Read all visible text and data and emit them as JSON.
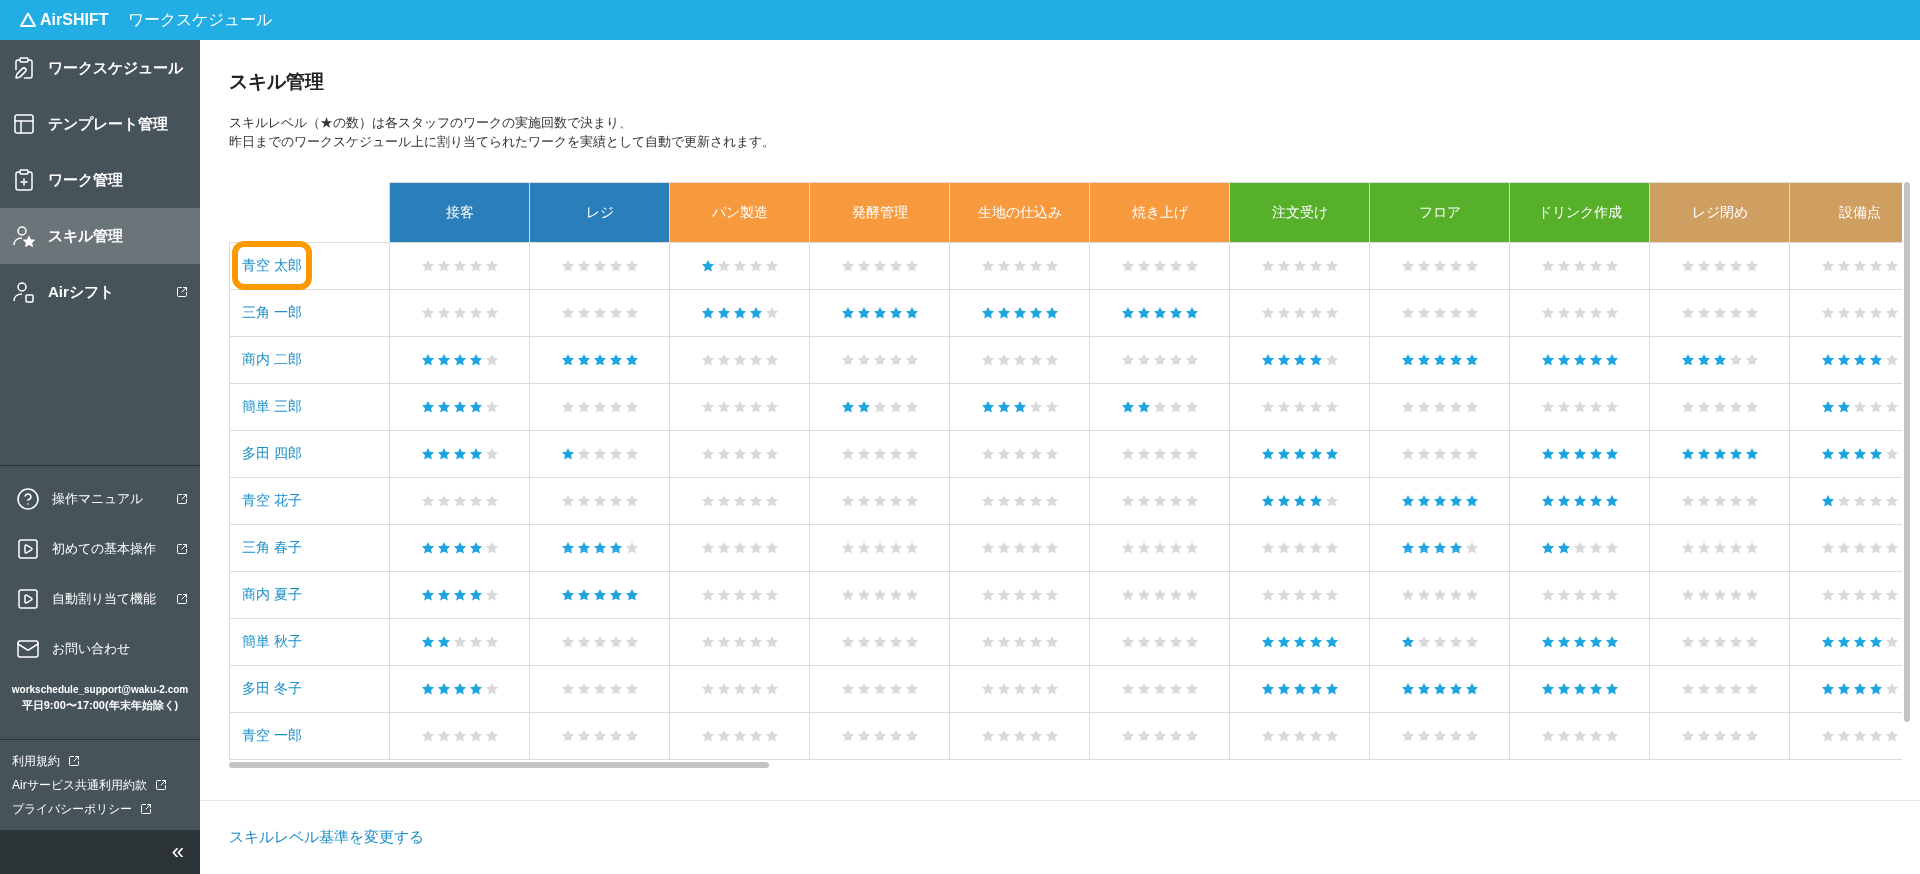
{
  "header": {
    "logo": "AirSHIFT",
    "title": "ワークスケジュール"
  },
  "sidebar": {
    "items": [
      {
        "label": "ワークスケジュール",
        "selected": false,
        "external": false
      },
      {
        "label": "テンプレート管理",
        "selected": false,
        "external": false
      },
      {
        "label": "ワーク管理",
        "selected": false,
        "external": false
      },
      {
        "label": "スキル管理",
        "selected": true,
        "external": false
      },
      {
        "label": "Airシフト",
        "selected": false,
        "external": true
      }
    ],
    "help_items": [
      {
        "label": "操作マニュアル",
        "external": true
      },
      {
        "label": "初めての基本操作",
        "external": true
      },
      {
        "label": "自動割り当て機能",
        "external": true
      },
      {
        "label": "お問い合わせ",
        "external": false
      }
    ],
    "contact_email": "workschedule_support@waku-2.com",
    "contact_hours": "平日9:00〜17:00(年末年始除く)",
    "footer_links": [
      {
        "label": "利用規約"
      },
      {
        "label": "Airサービス共通利用約款"
      },
      {
        "label": "プライバシーポリシー"
      }
    ],
    "collapse": "«"
  },
  "page": {
    "title": "スキル管理",
    "description": [
      "スキルレベル（★の数）は各スタッフのワークの実施回数で決まり、",
      "昨日までのワークスケジュール上に割り当てられたワークを実績として自動で更新されます。"
    ]
  },
  "table": {
    "columns": [
      {
        "label": "接客",
        "color": "#2a7fba"
      },
      {
        "label": "レジ",
        "color": "#2a7fba"
      },
      {
        "label": "パン製造",
        "color": "#f79a3e"
      },
      {
        "label": "発酵管理",
        "color": "#f79a3e"
      },
      {
        "label": "生地の仕込み",
        "color": "#f79a3e"
      },
      {
        "label": "焼き上げ",
        "color": "#f79a3e"
      },
      {
        "label": "注文受け",
        "color": "#56b02a"
      },
      {
        "label": "フロア",
        "color": "#56b02a"
      },
      {
        "label": "ドリンク作成",
        "color": "#56b02a"
      },
      {
        "label": "レジ閉め",
        "color": "#cf9f62"
      },
      {
        "label": "設備点",
        "color": "#cf9f62"
      }
    ],
    "rows": [
      {
        "name": "青空 太郎",
        "highlighted": true,
        "cells": [
          {
            "stars": 0
          },
          {
            "stars": 0
          },
          {
            "stars": 1
          },
          {
            "stars": 0
          },
          {
            "stars": 0
          },
          {
            "stars": 0
          },
          {
            "stars": 0
          },
          {
            "stars": 0
          },
          {
            "stars": 0
          },
          {
            "stars": 0
          },
          {
            "stars": 0
          }
        ]
      },
      {
        "name": "三角 一郎",
        "highlighted": false,
        "cells": [
          {
            "stars": 0
          },
          {
            "stars": 0
          },
          {
            "stars": 4
          },
          {
            "stars": 5
          },
          {
            "stars": 5
          },
          {
            "stars": 5
          },
          {
            "stars": 0
          },
          {
            "stars": 0
          },
          {
            "stars": 0
          },
          {
            "stars": 0
          },
          {
            "stars": 0
          }
        ]
      },
      {
        "name": "商内 二郎",
        "highlighted": false,
        "cells": [
          {
            "stars": 4
          },
          {
            "stars": 5
          },
          {
            "stars": 0
          },
          {
            "stars": 0
          },
          {
            "stars": 0
          },
          {
            "stars": 0
          },
          {
            "stars": 4
          },
          {
            "stars": 5
          },
          {
            "stars": 5
          },
          {
            "stars": 3
          },
          {
            "stars": 4
          }
        ]
      },
      {
        "name": "簡単 三郎",
        "highlighted": false,
        "cells": [
          {
            "stars": 4
          },
          {
            "stars": 0
          },
          {
            "stars": 0
          },
          {
            "stars": 2
          },
          {
            "stars": 3
          },
          {
            "stars": 2
          },
          {
            "stars": 0
          },
          {
            "stars": 0
          },
          {
            "stars": 0
          },
          {
            "stars": 0
          },
          {
            "stars": 2
          }
        ]
      },
      {
        "name": "多田 四郎",
        "highlighted": false,
        "cells": [
          {
            "stars": 4
          },
          {
            "stars": 1
          },
          {
            "stars": 0
          },
          {
            "stars": 0
          },
          {
            "stars": 0
          },
          {
            "stars": 0
          },
          {
            "stars": 5
          },
          {
            "stars": 0
          },
          {
            "stars": 5
          },
          {
            "stars": 5
          },
          {
            "stars": 4
          }
        ]
      },
      {
        "name": "青空 花子",
        "highlighted": false,
        "cells": [
          {
            "stars": 0
          },
          {
            "stars": 0
          },
          {
            "stars": 0
          },
          {
            "stars": 0
          },
          {
            "stars": 0
          },
          {
            "stars": 0
          },
          {
            "stars": 4
          },
          {
            "stars": 5
          },
          {
            "stars": 5
          },
          {
            "stars": 0
          },
          {
            "stars": 1
          }
        ]
      },
      {
        "name": "三角 春子",
        "highlighted": false,
        "cells": [
          {
            "stars": 4
          },
          {
            "stars": 4
          },
          {
            "stars": 0
          },
          {
            "stars": 0
          },
          {
            "stars": 0
          },
          {
            "stars": 0
          },
          {
            "stars": 0
          },
          {
            "stars": 4
          },
          {
            "stars": 2
          },
          {
            "stars": 0
          },
          {
            "stars": 0
          }
        ]
      },
      {
        "name": "商内 夏子",
        "highlighted": false,
        "cells": [
          {
            "stars": 4
          },
          {
            "stars": 5
          },
          {
            "stars": 0
          },
          {
            "stars": 0
          },
          {
            "stars": 0
          },
          {
            "stars": 0
          },
          {
            "stars": 0
          },
          {
            "stars": 0
          },
          {
            "stars": 0
          },
          {
            "stars": 0
          },
          {
            "stars": 0
          }
        ]
      },
      {
        "name": "簡単 秋子",
        "highlighted": false,
        "cells": [
          {
            "stars": 2
          },
          {
            "stars": 0
          },
          {
            "stars": 0
          },
          {
            "stars": 0
          },
          {
            "stars": 0
          },
          {
            "stars": 0
          },
          {
            "stars": 5
          },
          {
            "stars": 1
          },
          {
            "stars": 5
          },
          {
            "stars": 0
          },
          {
            "stars": 4
          }
        ]
      },
      {
        "name": "多田 冬子",
        "highlighted": false,
        "cells": [
          {
            "stars": 4
          },
          {
            "stars": 0
          },
          {
            "stars": 0
          },
          {
            "stars": 0
          },
          {
            "stars": 0
          },
          {
            "stars": 0
          },
          {
            "stars": 5
          },
          {
            "stars": 5
          },
          {
            "stars": 5
          },
          {
            "stars": 0
          },
          {
            "stars": 4
          }
        ]
      },
      {
        "name": "青空 一郎",
        "highlighted": false,
        "cells": [
          {
            "stars": 0
          },
          {
            "stars": 0
          },
          {
            "stars": 0
          },
          {
            "stars": 0
          },
          {
            "stars": 0
          },
          {
            "stars": 0
          },
          {
            "stars": 0
          },
          {
            "stars": 0
          },
          {
            "stars": 0
          },
          {
            "stars": 0
          },
          {
            "stars": 0
          }
        ]
      }
    ]
  },
  "footer": {
    "link": "スキルレベル基準を変更する"
  }
}
